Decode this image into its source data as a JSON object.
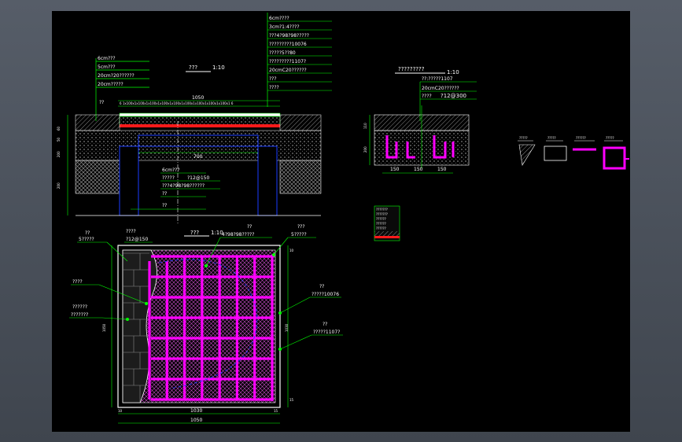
{
  "section_top": {
    "scale_label": "1:10",
    "title_mark": "???",
    "notes_left": [
      "6cm???",
      "5cm???",
      "20cm?20??????",
      "20cm?????"
    ],
    "notes_right": [
      "6cm????",
      "3cm?1:4????",
      "???4?98?98?????",
      "?????????10076",
      "?????5??80",
      "?????????1107?",
      "20cmC20??????",
      "???",
      "????"
    ],
    "dim_total": "1050",
    "dim_segments": "6 1x100x1x100x1x100x1x100x1x100x1x100x1x100x1x100x1x100x1 6",
    "dim_inner": "700",
    "dim_left_heights": [
      "60",
      "50",
      "200",
      "200"
    ],
    "note_middle": [
      "6cm???",
      "?????",
      "?12@150",
      "???4?98?98??????",
      "??"
    ],
    "note_bottom": "??",
    "side_mark": "??"
  },
  "plan": {
    "scale_label": "1:10",
    "title_mark": "???",
    "callouts": [
      "??",
      "5?????",
      "????",
      "?12@150",
      "??",
      "4?98?98?????",
      "???",
      "5?????",
      "????",
      "??????",
      "???????",
      "??",
      "?????10076",
      "??",
      "?????1107?"
    ],
    "dim_width_inner": "1030",
    "dim_width_total": "1050",
    "dim_height_total": "1050",
    "dim_height_inner": "1030",
    "dim_edges": [
      "10",
      "15",
      "10",
      "15"
    ]
  },
  "section_right": {
    "title_mark": "?????????",
    "scale_label": "1:10",
    "notes": [
      "??:?????1107",
      "20cmC20??????",
      "????",
      "?12@300"
    ],
    "dims_bottom": [
      "150",
      "150",
      "150"
    ],
    "dims_left": [
      "110",
      "200"
    ]
  },
  "small_details": {
    "labels": [
      "?????",
      "?????",
      "??????",
      "?????"
    ]
  },
  "legend_box": {
    "lines": [
      "???????",
      "???????",
      "??????",
      "??????",
      "??????"
    ]
  },
  "colors": {
    "background": "#000000",
    "frame": "#4a515b",
    "white": "#ffffff",
    "green": "#00ff00",
    "magenta": "#ff00ff",
    "blue": "#1a3cff",
    "red": "#ff1a1a",
    "gray": "#8a8a8a"
  }
}
